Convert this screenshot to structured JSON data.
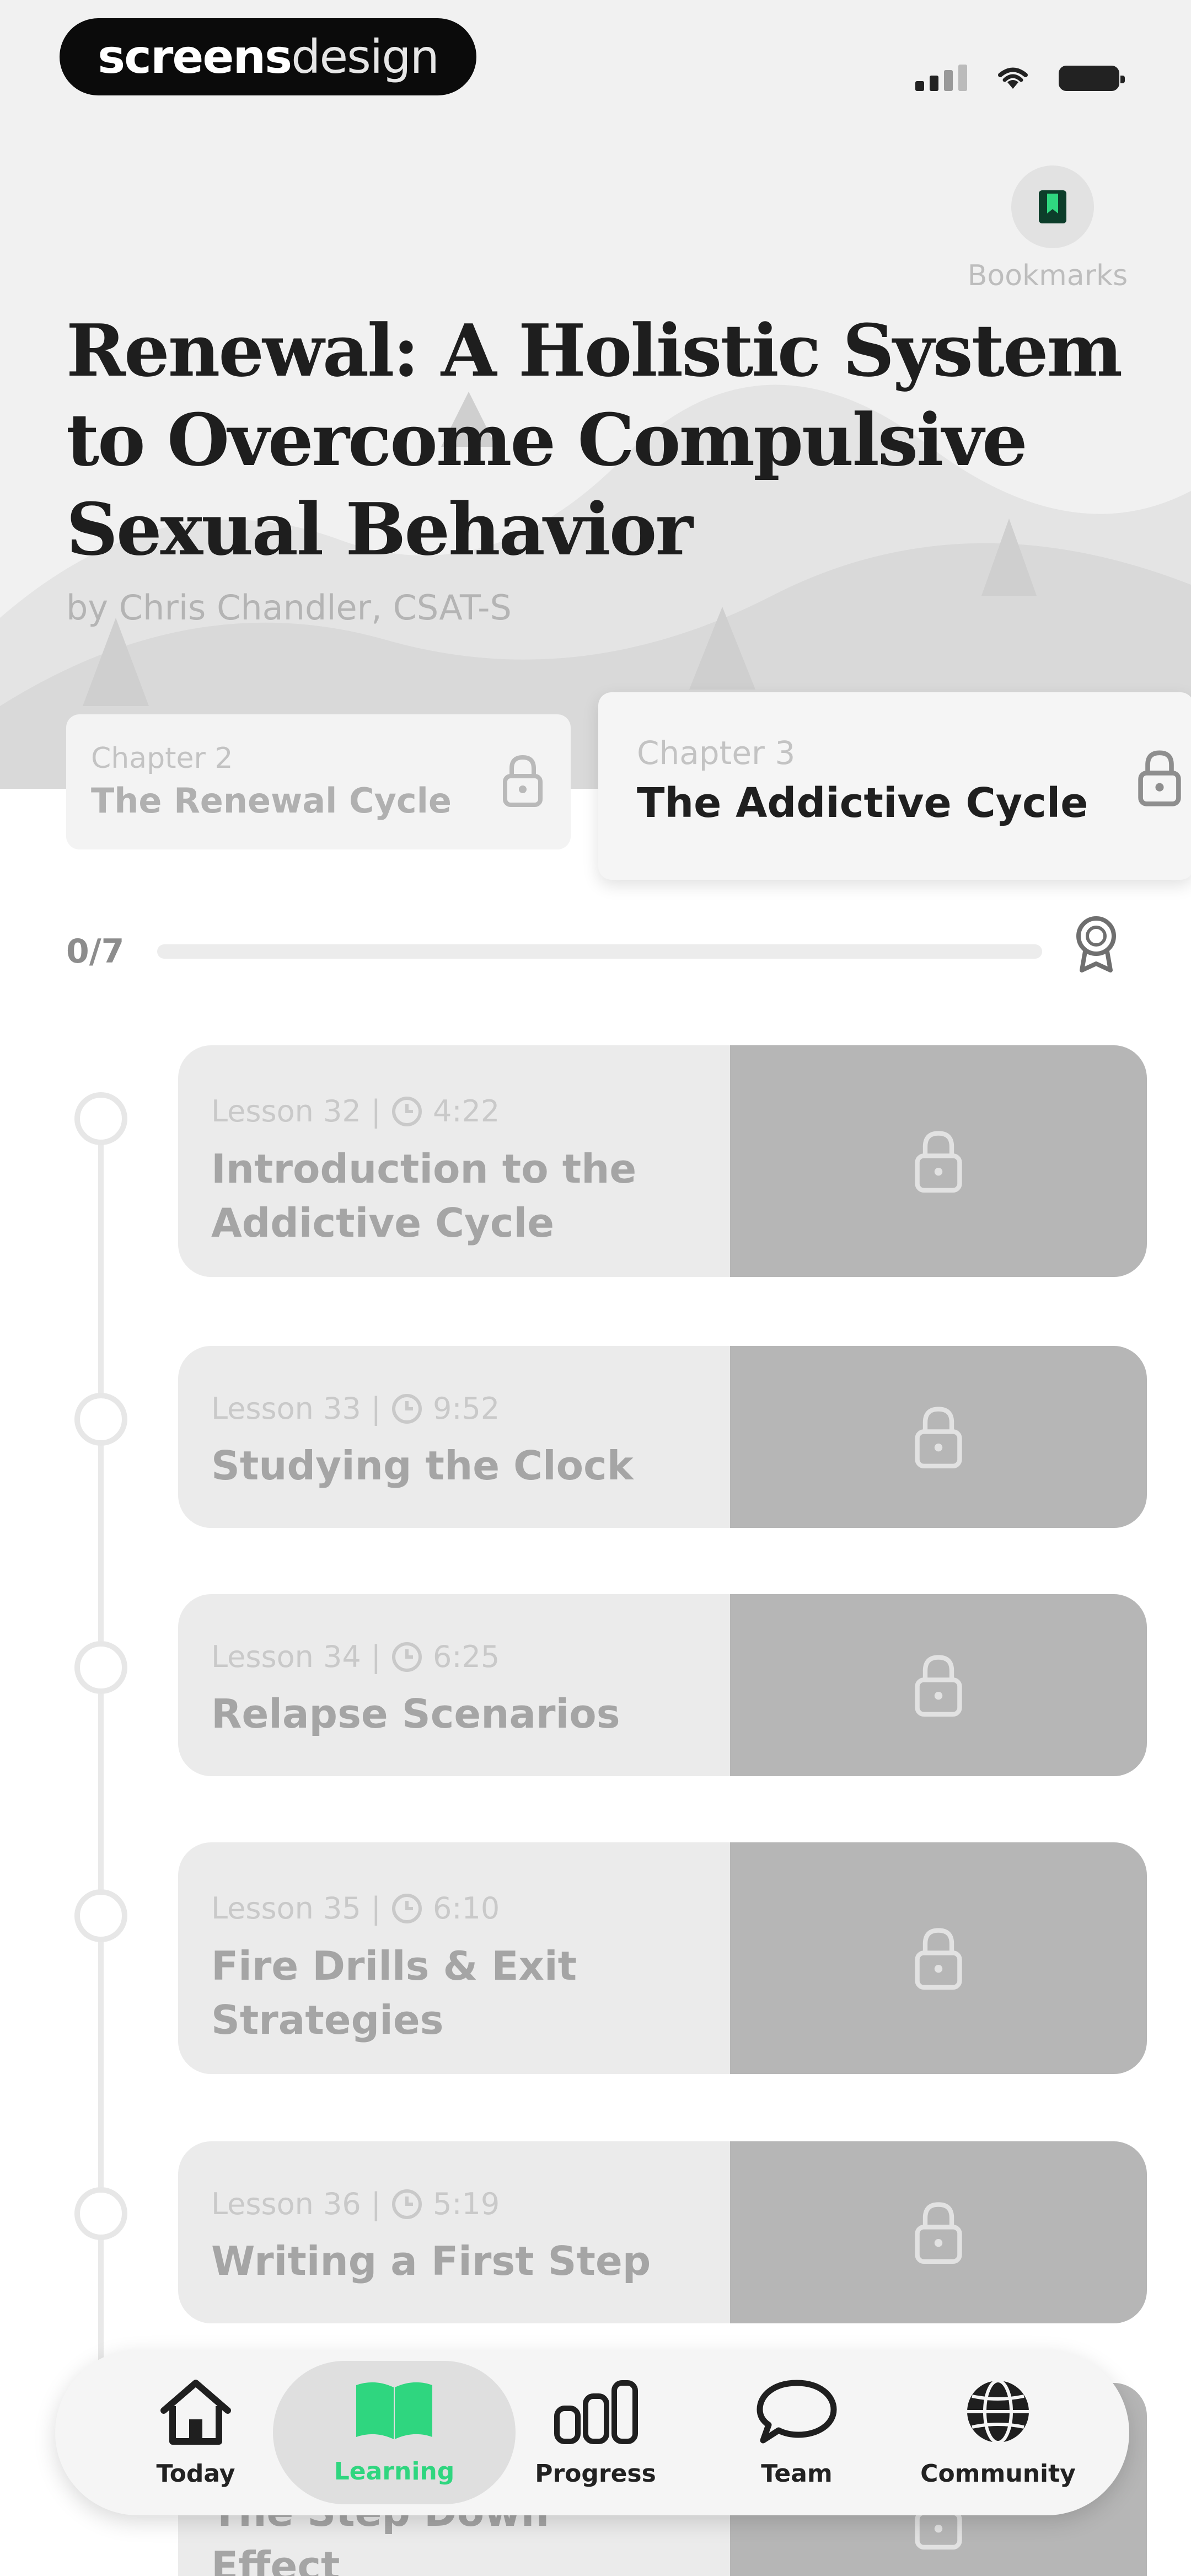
{
  "brand": {
    "logo_bold": "screens",
    "logo_light": "design"
  },
  "header": {
    "bookmarks_label": "Bookmarks",
    "title": "Renewal: A Holistic System to Overcome Compulsive Sexual Behavior",
    "author": "by Chris Chandler, CSAT-S"
  },
  "chapters": [
    {
      "kicker": "Chapter 2",
      "name": "The Renewal Cycle",
      "locked": true
    },
    {
      "kicker": "Chapter 3",
      "name": "The Addictive Cycle",
      "locked": true,
      "selected": true
    }
  ],
  "progress": {
    "text": "0/7",
    "completed": 0,
    "total": 7
  },
  "lessons": [
    {
      "number": "Lesson 32",
      "duration": "4:22",
      "title": "Introduction to the Addictive Cycle"
    },
    {
      "number": "Lesson 33",
      "duration": "9:52",
      "title": "Studying the Clock"
    },
    {
      "number": "Lesson 34",
      "duration": "6:25",
      "title": "Relapse Scenarios"
    },
    {
      "number": "Lesson 35",
      "duration": "6:10",
      "title": "Fire Drills & Exit Strategies"
    },
    {
      "number": "Lesson 36",
      "duration": "5:19",
      "title": "Writing a First Step"
    },
    {
      "title": "The Step Down Effect"
    }
  ],
  "nav": {
    "items": [
      {
        "label": "Today",
        "icon": "home-icon"
      },
      {
        "label": "Learning",
        "icon": "book-icon",
        "active": true
      },
      {
        "label": "Progress",
        "icon": "bar-chart-icon"
      },
      {
        "label": "Team",
        "icon": "chat-bubble-icon"
      },
      {
        "label": "Community",
        "icon": "globe-icon"
      }
    ]
  },
  "colors": {
    "accent": "#2fd67f",
    "locked_pane": "#b6b6b6",
    "card_bg": "#ebebeb"
  }
}
